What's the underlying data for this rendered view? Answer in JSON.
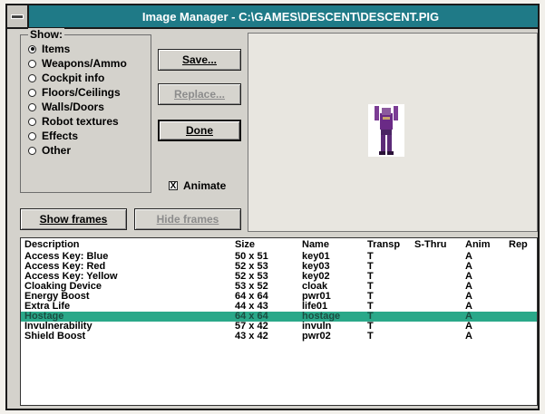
{
  "window": {
    "title": "Image Manager - C:\\GAMES\\DESCENT\\DESCENT.PIG"
  },
  "show_group": {
    "label": "Show:",
    "options": [
      {
        "label": "Items",
        "selected": true
      },
      {
        "label": "Weapons/Ammo",
        "selected": false
      },
      {
        "label": "Cockpit info",
        "selected": false
      },
      {
        "label": "Floors/Ceilings",
        "selected": false
      },
      {
        "label": "Walls/Doors",
        "selected": false
      },
      {
        "label": "Robot textures",
        "selected": false
      },
      {
        "label": "Effects",
        "selected": false
      },
      {
        "label": "Other",
        "selected": false
      }
    ]
  },
  "buttons": {
    "save": "Save...",
    "replace": "Replace...",
    "done": "Done",
    "show_frames": "Show frames",
    "hide_frames": "Hide frames"
  },
  "animate": {
    "label": "Animate",
    "checked": true,
    "mark": "X"
  },
  "list": {
    "columns": [
      "Description",
      "Size",
      "Name",
      "Transp",
      "S-Thru",
      "Anim",
      "Rep"
    ],
    "rows": [
      {
        "description": "Access Key: Blue",
        "size": "50 x 51",
        "name": "key01",
        "transp": "T",
        "sthru": "",
        "anim": "A",
        "rep": ""
      },
      {
        "description": "Access Key: Red",
        "size": "52 x 53",
        "name": "key03",
        "transp": "T",
        "sthru": "",
        "anim": "A",
        "rep": ""
      },
      {
        "description": "Access Key: Yellow",
        "size": "52 x 53",
        "name": "key02",
        "transp": "T",
        "sthru": "",
        "anim": "A",
        "rep": ""
      },
      {
        "description": "Cloaking Device",
        "size": "53 x 52",
        "name": "cloak",
        "transp": "T",
        "sthru": "",
        "anim": "A",
        "rep": ""
      },
      {
        "description": "Energy Boost",
        "size": "64 x 64",
        "name": "pwr01",
        "transp": "T",
        "sthru": "",
        "anim": "A",
        "rep": ""
      },
      {
        "description": "Extra Life",
        "size": "44 x 43",
        "name": "life01",
        "transp": "T",
        "sthru": "",
        "anim": "A",
        "rep": ""
      },
      {
        "description": "Hostage",
        "size": "64 x 64",
        "name": "hostage",
        "transp": "T",
        "sthru": "",
        "anim": "A",
        "rep": "",
        "selected": true
      },
      {
        "description": "Invulnerability",
        "size": "57 x 42",
        "name": "invuln",
        "transp": "T",
        "sthru": "",
        "anim": "A",
        "rep": ""
      },
      {
        "description": "Shield Boost",
        "size": "43 x 42",
        "name": "pwr02",
        "transp": "T",
        "sthru": "",
        "anim": "A",
        "rep": ""
      }
    ]
  },
  "colors": {
    "title_bar": "#1f7a87",
    "selected_row": "#2aa889",
    "dialog_bg": "#d4d2cc"
  }
}
